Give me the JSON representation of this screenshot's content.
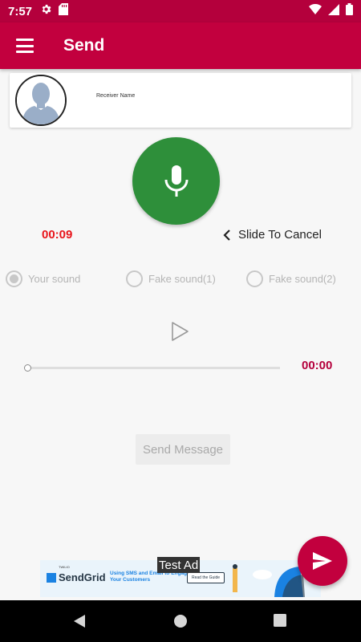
{
  "status_bar": {
    "time": "7:57",
    "icons": [
      "gear-icon",
      "sd-card-icon",
      "wifi-icon",
      "signal-icon",
      "battery-icon"
    ]
  },
  "app_bar": {
    "title": "Send",
    "menu_icon": "menu-icon"
  },
  "receiver": {
    "name": "Receiver Name"
  },
  "recorder": {
    "timer": "00:09",
    "slide_to_cancel": "Slide To Cancel"
  },
  "sound_options": [
    {
      "label": "Your sound",
      "selected": true
    },
    {
      "label": "Fake sound(1)",
      "selected": false
    },
    {
      "label": "Fake sound(2)",
      "selected": false
    }
  ],
  "player": {
    "duration": "00:00",
    "progress": 0
  },
  "send_message_label": "Send Message",
  "ad": {
    "label": "Test Ad",
    "brand_small": "TWILIO",
    "brand": "SendGrid",
    "copy": "Using SMS and Email to Engage Your Customers",
    "cta": "Read the Guide"
  },
  "colors": {
    "primary": "#c2003e",
    "status_bar": "#b4003c",
    "mic": "#2e8f3a",
    "timer": "#e8151b"
  }
}
